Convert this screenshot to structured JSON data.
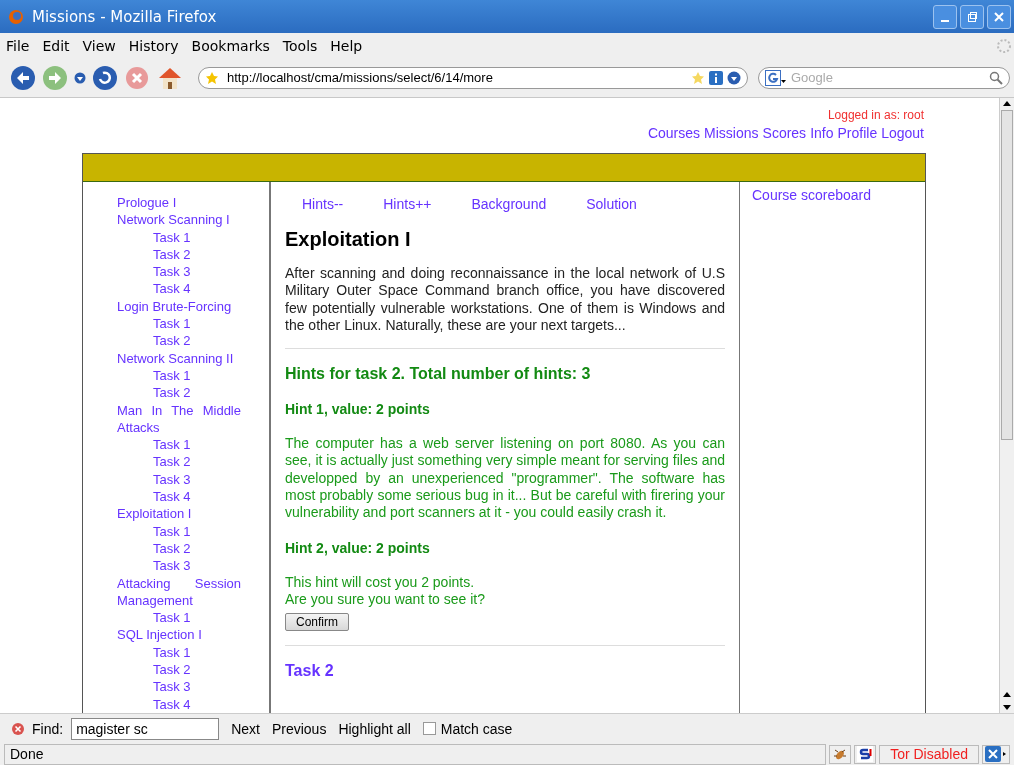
{
  "window": {
    "title": "Missions - Mozilla Firefox"
  },
  "menu": [
    "File",
    "Edit",
    "View",
    "History",
    "Bookmarks",
    "Tools",
    "Help"
  ],
  "address_bar": {
    "value": "http://localhost/cma/missions/select/6/14/more"
  },
  "search_bar": {
    "placeholder": "Google"
  },
  "header": {
    "login": "Logged in as: root",
    "links": [
      "Courses",
      "Missions",
      "Scores",
      "Info",
      "Profile",
      "Logout"
    ]
  },
  "sidebar": {
    "items": [
      {
        "label": "Prologue I"
      },
      {
        "label": "Network Scanning I",
        "children": [
          {
            "label": "Task 1"
          },
          {
            "label": "Task 2"
          },
          {
            "label": "Task 3"
          },
          {
            "label": "Task 4"
          }
        ]
      },
      {
        "label": "Login Brute-Forcing",
        "children": [
          {
            "label": "Task 1"
          },
          {
            "label": "Task 2"
          }
        ]
      },
      {
        "label": "Network Scanning II",
        "children": [
          {
            "label": "Task 1"
          },
          {
            "label": "Task 2"
          }
        ]
      },
      {
        "label": "Man In The Middle Attacks",
        "children": [
          {
            "label": "Task 1"
          },
          {
            "label": "Task 2"
          },
          {
            "label": "Task 3"
          },
          {
            "label": "Task 4"
          }
        ]
      },
      {
        "label": "Exploitation I",
        "children": [
          {
            "label": "Task 1"
          },
          {
            "label": "Task 2"
          },
          {
            "label": "Task 3"
          }
        ]
      },
      {
        "label": "Attacking Session Management",
        "children": [
          {
            "label": "Task 1"
          }
        ]
      },
      {
        "label": "SQL Injection I",
        "children": [
          {
            "label": "Task 1"
          },
          {
            "label": "Task 2"
          },
          {
            "label": "Task 3"
          },
          {
            "label": "Task 4"
          }
        ]
      }
    ]
  },
  "tabs": [
    "Hints--",
    "Hints++",
    "Background",
    "Solution"
  ],
  "mission": {
    "title": "Exploitation I",
    "description": "After scanning and doing reconnaissance in the local network of U.S Military Outer Space Command branch office, you have discovered few potentially vulnerable workstations. One of them is Windows and the other Linux. Naturally, these are your next targets..."
  },
  "hints": {
    "title": "Hints for task 2. Total number of hints: 3",
    "items": [
      {
        "title": "Hint 1, value: 2 points",
        "kind": "revealed",
        "text": "The computer has a web server listening on port 8080. As you can see, it is actually just something very simple meant for serving files and developped by an unexperienced \"programmer\". The software has most probably some serious bug in it... But be careful with firering your vulnerability and port scanners at it - you could easily crash it."
      },
      {
        "title": "Hint 2, value: 2 points",
        "kind": "locked",
        "lines": [
          "This hint will cost you 2 points.",
          "Are you sure you want to see it?"
        ],
        "button": "Confirm"
      }
    ]
  },
  "next_section": {
    "title": "Task 2"
  },
  "right_panel": {
    "link": "Course scoreboard"
  },
  "find_bar": {
    "label": "Find:",
    "value": "magister sc",
    "buttons": [
      "Next",
      "Previous",
      "Highlight all"
    ],
    "match_case": {
      "label": "Match case",
      "checked": false
    }
  },
  "status_bar": {
    "text": "Done",
    "tor": "Tor Disabled"
  }
}
